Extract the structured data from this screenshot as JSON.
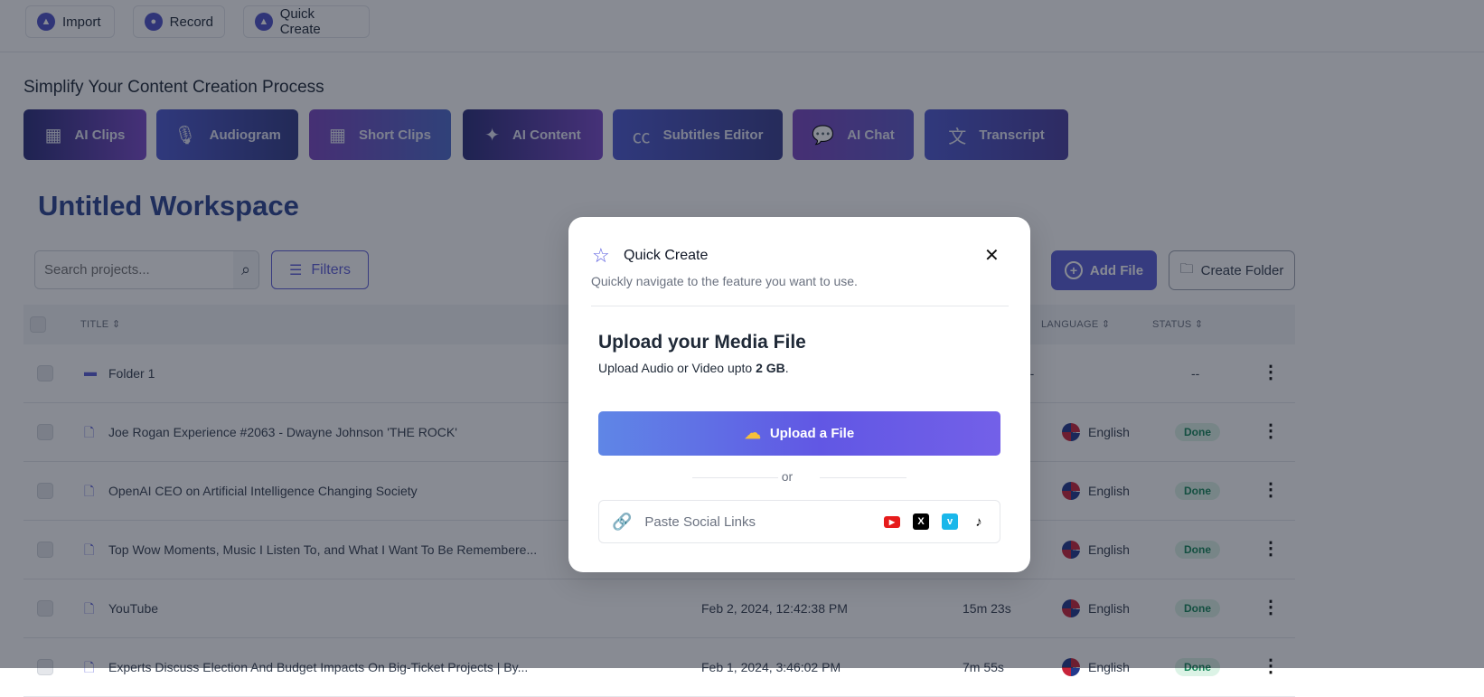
{
  "toolbar": {
    "import": "Import",
    "record": "Record",
    "quick_create": "Quick Create"
  },
  "section_title": "Simplify Your Content Creation Process",
  "features": [
    {
      "label": "AI Clips",
      "icon": "film-icon"
    },
    {
      "label": "Audiogram",
      "icon": "microphone-icon"
    },
    {
      "label": "Short Clips",
      "icon": "film-icon"
    },
    {
      "label": "AI Content",
      "icon": "sparkles-icon"
    },
    {
      "label": "Subtitles Editor",
      "icon": "cc-icon"
    },
    {
      "label": "AI Chat",
      "icon": "chat-icon"
    },
    {
      "label": "Transcript",
      "icon": "translate-icon"
    }
  ],
  "workspace_title": "Untitled Workspace",
  "search": {
    "placeholder": "Search projects..."
  },
  "filters_label": "Filters",
  "add_file_label": "Add File",
  "create_folder_label": "Create Folder",
  "table": {
    "headers": {
      "title": "TITLE",
      "language": "LANGUAGE",
      "status": "STATUS"
    },
    "rows": [
      {
        "type": "folder",
        "title": "Folder 1",
        "date": "",
        "duration": "",
        "language": "--",
        "status": "--"
      },
      {
        "type": "file",
        "title": "Joe Rogan Experience #2063 - Dwayne Johnson 'THE ROCK'",
        "date": "",
        "duration": "",
        "language": "English",
        "status": "Done"
      },
      {
        "type": "file",
        "title": "OpenAI CEO on Artificial Intelligence Changing Society",
        "date": "",
        "duration": "",
        "language": "English",
        "status": "Done"
      },
      {
        "type": "file",
        "title": "Top Wow Moments, Music I Listen To, and What I Want To Be Remembere...",
        "date": "",
        "duration": "",
        "language": "English",
        "status": "Done"
      },
      {
        "type": "file",
        "title": "YouTube",
        "date": "Feb 2, 2024, 12:42:38 PM",
        "duration": "15m 23s",
        "language": "English",
        "status": "Done"
      },
      {
        "type": "file",
        "title": "Experts Discuss Election And Budget Impacts On Big-Ticket Projects | By...",
        "date": "Feb 1, 2024, 3:46:02 PM",
        "duration": "7m 55s",
        "language": "English",
        "status": "Done"
      }
    ]
  },
  "modal": {
    "title": "Quick Create",
    "subtitle": "Quickly navigate to the feature you want to use.",
    "upload_heading": "Upload your Media File",
    "upload_desc_prefix": "Upload Audio or Video upto ",
    "upload_limit": "2 GB",
    "upload_desc_suffix": ".",
    "upload_button": "Upload a File",
    "or": "or",
    "paste_placeholder": "Paste Social Links",
    "socials": [
      "youtube-icon",
      "x-icon",
      "vimeo-icon",
      "tiktok-icon"
    ]
  },
  "colors": {
    "accent": "#5b5fd6",
    "done_text": "#16875a",
    "done_bg": "#dcf3e6"
  }
}
